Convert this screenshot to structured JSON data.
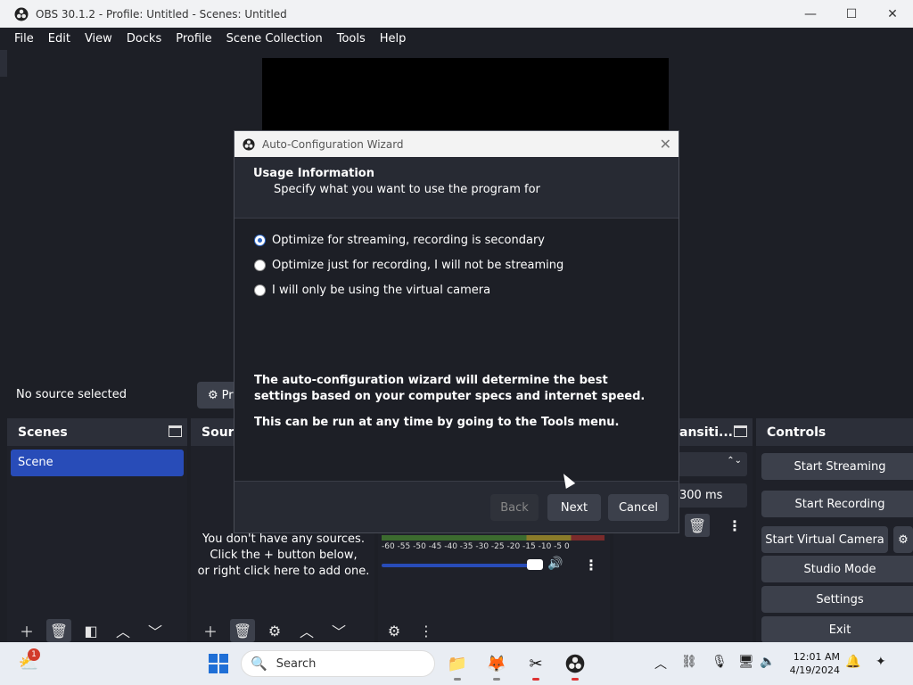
{
  "window": {
    "title": "OBS 30.1.2 - Profile: Untitled - Scenes: Untitled",
    "minimize": "—",
    "maximize": "☐",
    "close": "✕"
  },
  "menu": [
    "File",
    "Edit",
    "View",
    "Docks",
    "Profile",
    "Scene Collection",
    "Tools",
    "Help"
  ],
  "source_bar": {
    "no_source": "No source selected",
    "properties_label": "Pr"
  },
  "docks": {
    "scenes": {
      "title": "Scenes",
      "items": [
        "Scene"
      ]
    },
    "sources": {
      "title": "Sourc",
      "empty_line1": "You don't have any sources.",
      "empty_line2": "Click the + button below,",
      "empty_line3": "or right click here to add one."
    },
    "audio": {
      "scale": "-60 -55 -50 -45 -40 -35 -30 -25 -20 -15 -10 -5 0",
      "volume_fraction": 0.93
    },
    "transitions": {
      "title": "ansiti...",
      "duration": "300 ms"
    },
    "controls": {
      "title": "Controls",
      "buttons": [
        "Start Streaming",
        "Start Recording",
        "Start Virtual Camera",
        "Studio Mode",
        "Settings",
        "Exit"
      ]
    }
  },
  "dialog": {
    "title": "Auto-Configuration Wizard",
    "close": "✕",
    "heading": "Usage Information",
    "subheading": "Specify what you want to use the program for",
    "options": [
      {
        "label": "Optimize for streaming, recording is secondary",
        "checked": true
      },
      {
        "label": "Optimize just for recording, I will not be streaming",
        "checked": false
      },
      {
        "label": "I will only be using the virtual camera",
        "checked": false
      }
    ],
    "info1": "The auto-configuration wizard will determine the best settings based on your computer specs and internet speed.",
    "info2": "This can be run at any time by going to the Tools menu.",
    "buttons": {
      "back": "Back",
      "next": "Next",
      "cancel": "Cancel"
    }
  },
  "taskbar": {
    "search_placeholder": "Search",
    "weather_badge": "1",
    "time": "12:01 AM",
    "date": "4/19/2024"
  }
}
